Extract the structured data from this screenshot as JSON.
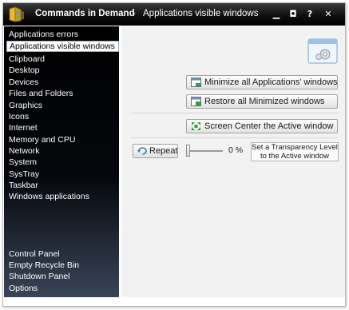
{
  "window": {
    "app_name": "Commands in Demand",
    "separator": "-",
    "page_title": "Applications visible windows",
    "controls": {
      "minimize": "▁",
      "restore": "◘",
      "help": "?",
      "close": "✕"
    }
  },
  "sidebar": {
    "items": [
      {
        "label": "Applications errors"
      },
      {
        "label": "Applications visible windows",
        "selected": true
      },
      {
        "label": "Clipboard"
      },
      {
        "label": "Desktop"
      },
      {
        "label": "Devices"
      },
      {
        "label": "Files and Folders"
      },
      {
        "label": "Graphics"
      },
      {
        "label": "Icons"
      },
      {
        "label": "Internet"
      },
      {
        "label": "Memory and CPU"
      },
      {
        "label": "Network"
      },
      {
        "label": "System"
      },
      {
        "label": "SysTray"
      },
      {
        "label": "Taskbar"
      },
      {
        "label": "Windows applications"
      }
    ],
    "bottom_items": [
      {
        "label": "Control Panel"
      },
      {
        "label": "Empty Recycle Bin"
      },
      {
        "label": "Shutdown Panel"
      },
      {
        "label": "Options"
      }
    ]
  },
  "main": {
    "header_icon": "window-settings-icon",
    "minimize_all_label": "Minimize all Applications' windows",
    "restore_all_label": "Restore all Minimized windows",
    "center_label": "Screen Center the Active window",
    "repeat_label": "Repeat",
    "transparency_percent_label": "0 %",
    "transparency_value": 0,
    "transparency_line1": "Set a Transparency Level",
    "transparency_line2": "to the Active window"
  },
  "colors": {
    "titlebar": "#000000",
    "sidebar": "#000000",
    "sidebar_bottom": "#3a4458",
    "content_bg": "#f2f2f2",
    "accent_green": "#3aa03a"
  }
}
